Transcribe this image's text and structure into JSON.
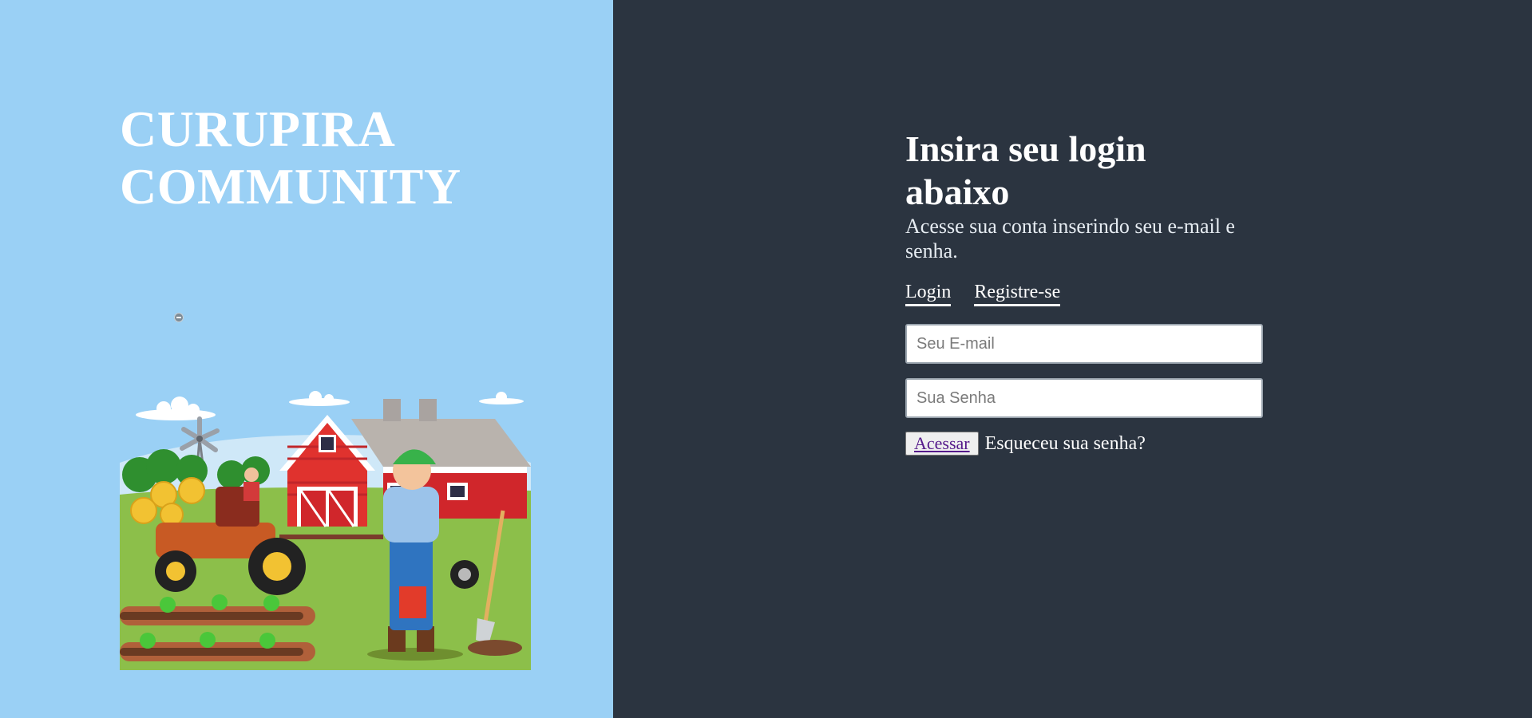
{
  "brand": {
    "line1": "CURUPIRA",
    "line2": "COMMUNITY"
  },
  "illustration": {
    "subject": "farm-illustration"
  },
  "login": {
    "title": "Insira seu login abaixo",
    "subtitle": "Acesse sua conta inserindo seu e-mail e senha.",
    "tabs": [
      {
        "label": "Login"
      },
      {
        "label": "Registre-se"
      }
    ],
    "email_placeholder": "Seu E-mail",
    "password_placeholder": "Sua Senha",
    "submit_label": "Acessar",
    "forgot_label": "Esqueceu sua senha?"
  },
  "colors": {
    "left_bg": "#9ad0f5",
    "right_bg": "#2b3440",
    "text": "#ffffff"
  }
}
